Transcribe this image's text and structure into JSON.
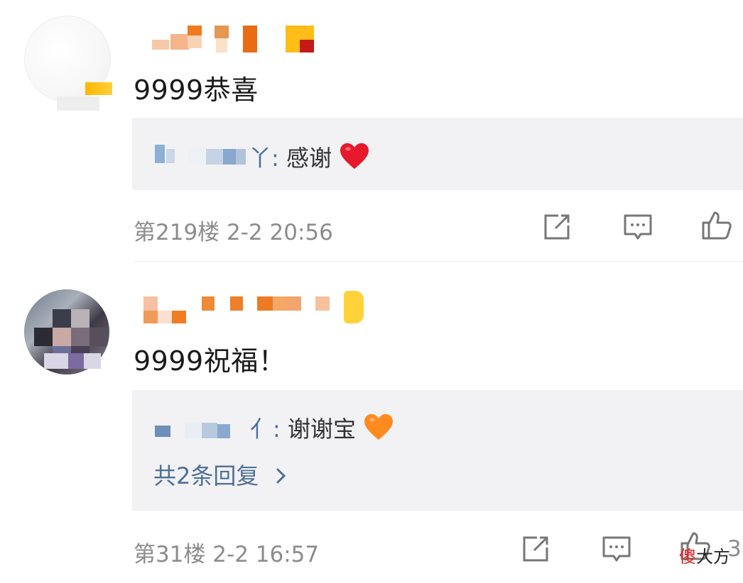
{
  "comments": [
    {
      "text": "9999恭喜",
      "reply_user_suffix": "丫:",
      "reply_text": "感谢",
      "reply_emoji": "heart-red",
      "floor_time": "第219楼 2-2 20:56"
    },
    {
      "text": "9999祝福！",
      "reply_user_suffix": "亻:",
      "reply_text": "谢谢宝",
      "reply_emoji": "heart-orange",
      "more_replies": "共2条回复",
      "floor_time": "第31楼 2-2 16:57",
      "like_count": "3"
    }
  ],
  "icons": {
    "share": "share-icon",
    "comment": "comment-icon",
    "like": "thumbs-up-icon"
  },
  "colors": {
    "reply_bg": "#f2f2f4",
    "link": "#4d6f99",
    "meta": "#8c8c8c",
    "heart_red": "#e8192c",
    "heart_orange": "#ff8a1f"
  },
  "watermark": {
    "part1": "傻",
    "part2": "大方"
  }
}
